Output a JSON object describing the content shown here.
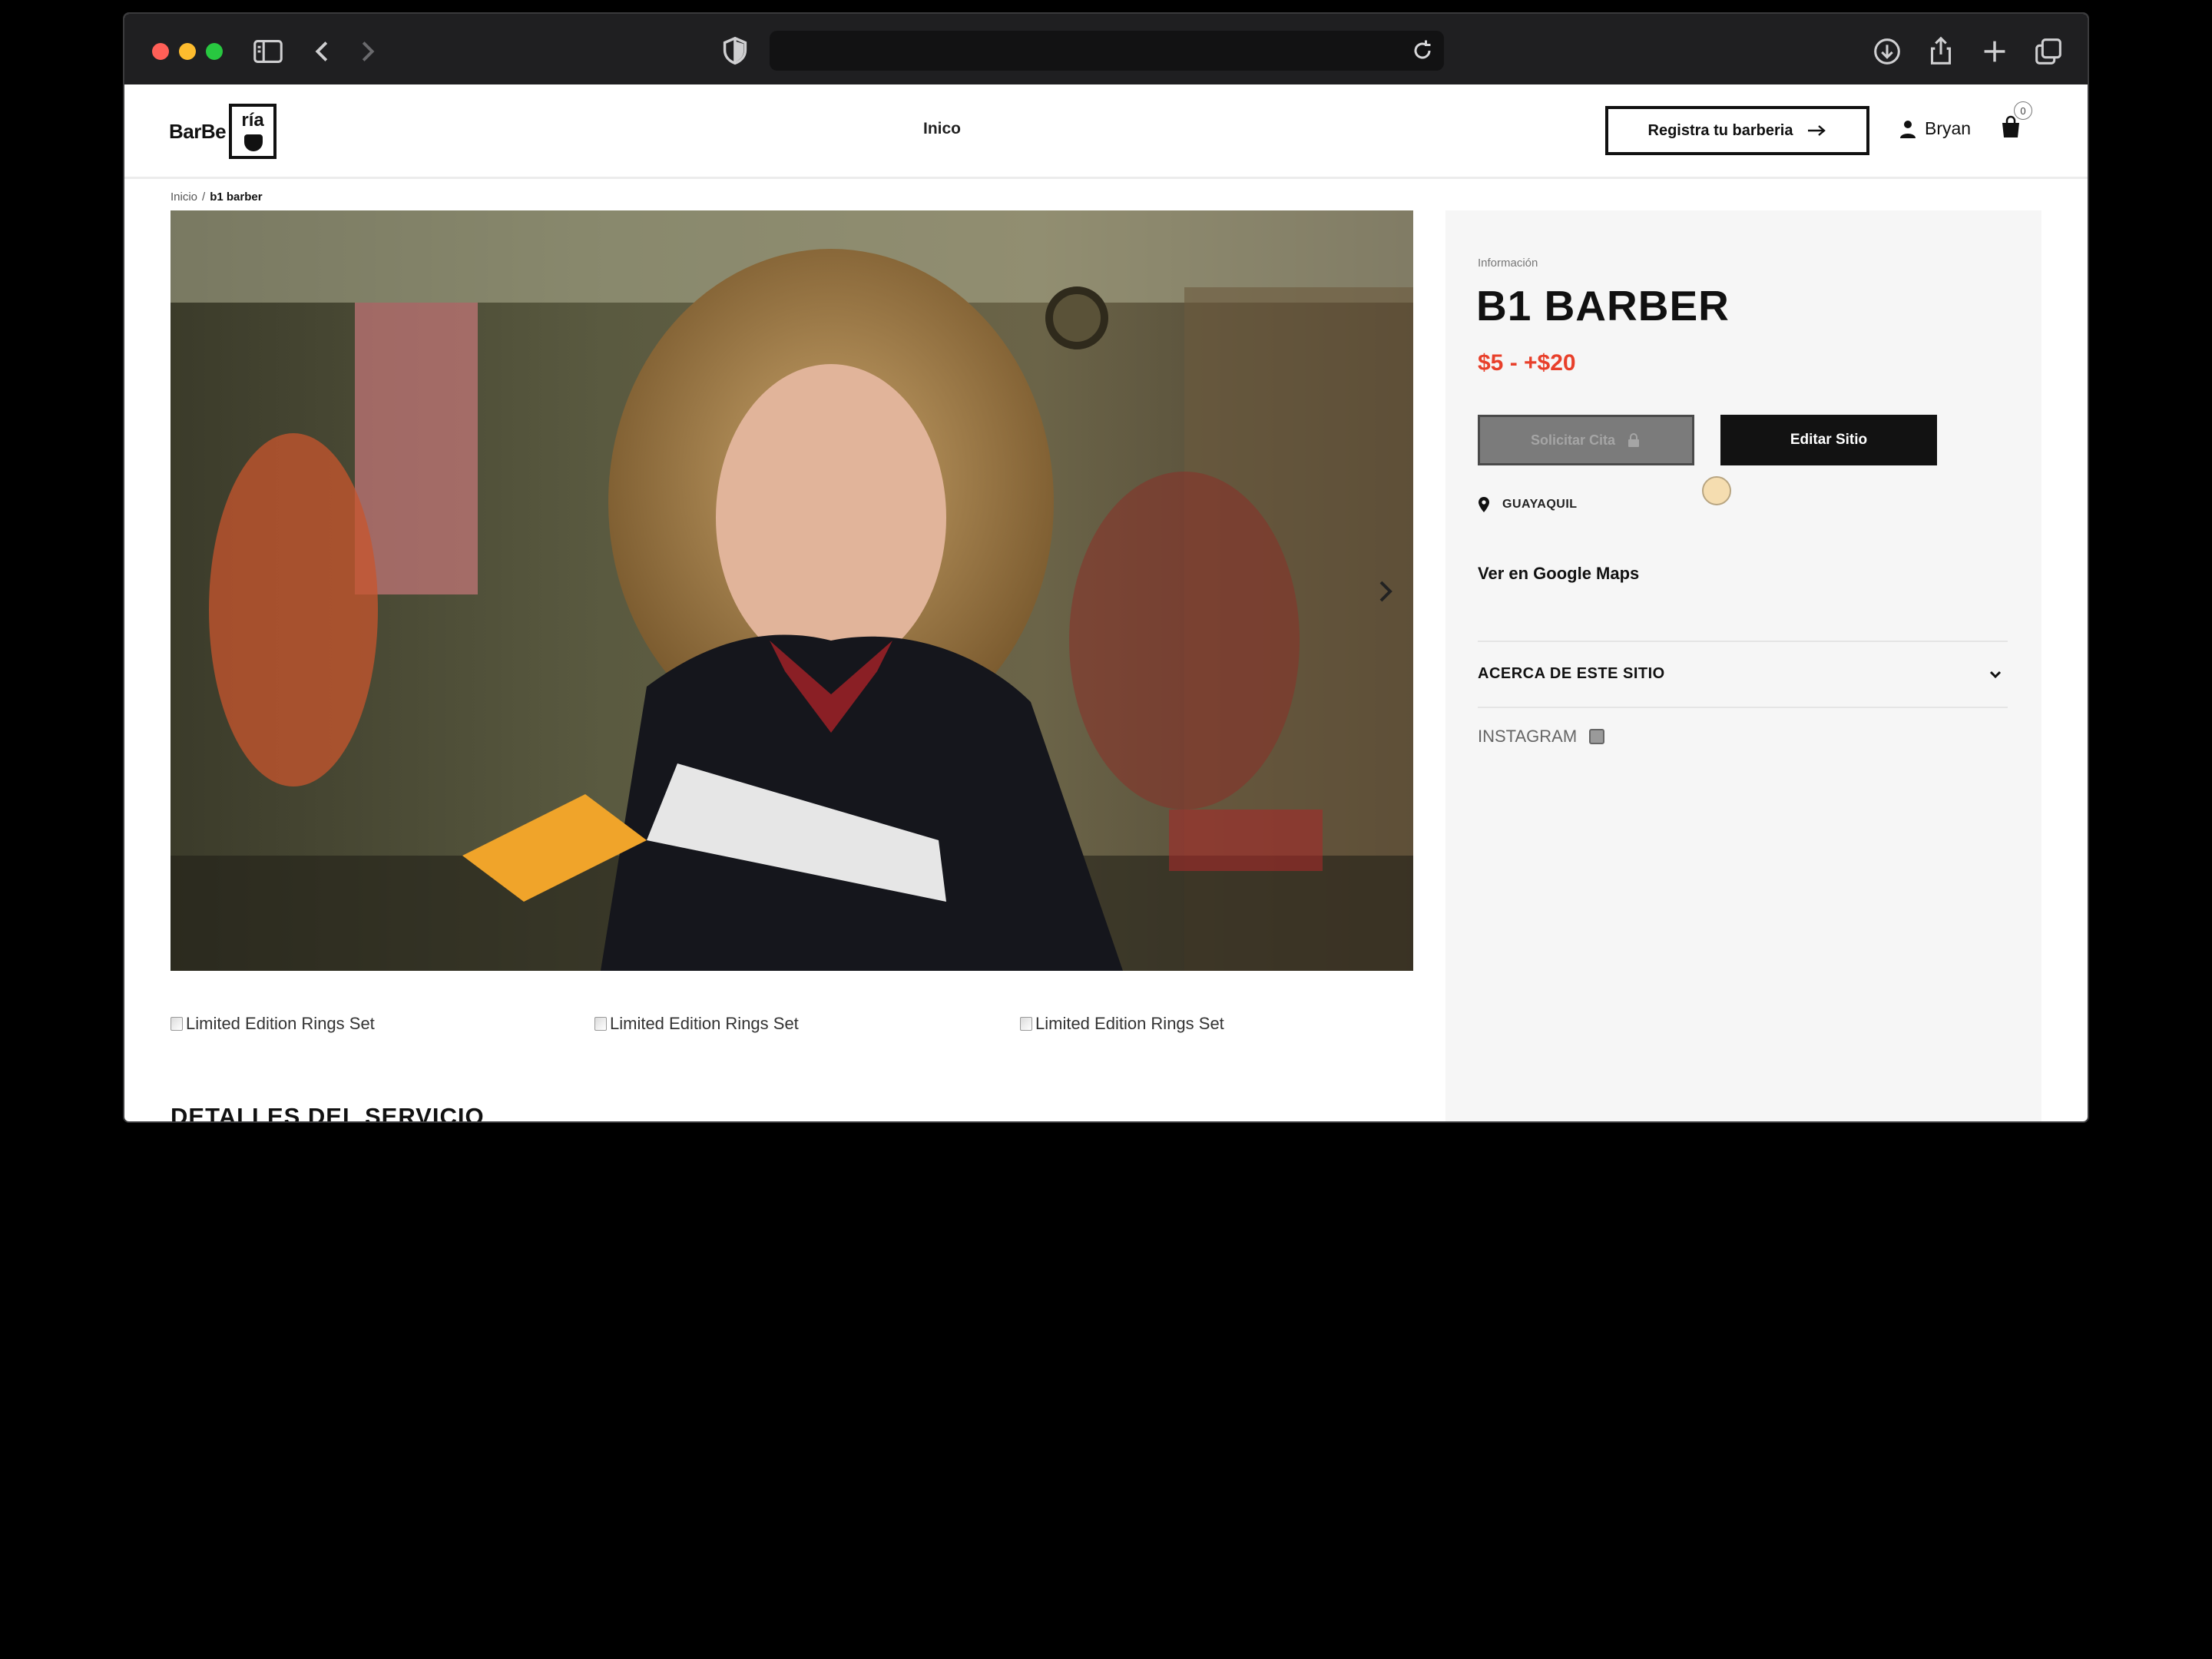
{
  "browser": {
    "address_text": ""
  },
  "header": {
    "logo_text": "BarBe",
    "logo_box_text": "ría",
    "nav_home": "Inico",
    "register_button": "Registra tu barberia",
    "user_name": "Bryan",
    "cart_count": "0"
  },
  "breadcrumb": {
    "home": "Inicio",
    "separator": "/",
    "current": "b1 barber"
  },
  "gallery": {
    "thumbnails": [
      "Limited Edition Rings Set",
      "Limited Edition Rings Set",
      "Limited Edition Rings Set"
    ]
  },
  "details": {
    "section_title": "DETALLES DEL SERVICIO"
  },
  "panel": {
    "label": "Información",
    "title": "B1 BARBER",
    "price": "$5 - +$20",
    "request_button": "Solicitar Cita",
    "edit_button": "Editar Sitio",
    "location": "GUAYAQUIL",
    "maps_link": "Ver en Google Maps",
    "accordion_label": "ACERCA DE ESTE SITIO",
    "instagram_label": "INSTAGRAM"
  },
  "colors": {
    "price": "#e8402b",
    "primary_button": "#121212",
    "disabled_button": "#7b7b7b",
    "panel_background": "#f6f6f6"
  },
  "icons": {
    "sidebar": "sidebar-icon",
    "back": "chevron-left-icon",
    "forward": "chevron-right-icon",
    "shield": "shield-icon",
    "reload": "reload-icon",
    "download": "download-icon",
    "share": "share-icon",
    "new_tab": "plus-icon",
    "tabs": "tabs-overview-icon",
    "user": "user-icon",
    "cart": "shopping-bag-icon",
    "location": "map-pin-icon",
    "chevron": "chevron-down-icon",
    "lock": "lock-icon",
    "instagram": "instagram-icon"
  }
}
